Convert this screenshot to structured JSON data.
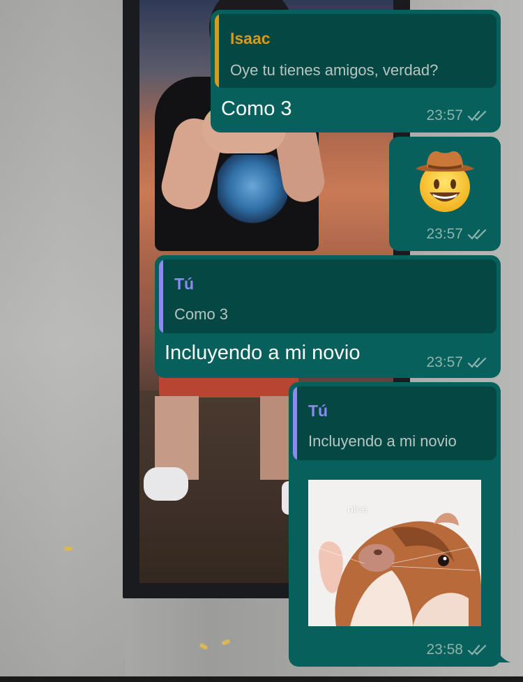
{
  "colors": {
    "bubble": "#07605c",
    "quote_bg": "#044743",
    "isaac_name": "#d89a1a",
    "tu_name": "#8a8af0",
    "time": "#8db4ae"
  },
  "messages": [
    {
      "quote": {
        "author": "Isaac",
        "text": "Oye tu tienes amigos, verdad?"
      },
      "text": "Como 3",
      "time": "23:57",
      "status_icon": "double-check-icon"
    },
    {
      "emoji": "cowboy-hat-face-emoji",
      "time": "23:57",
      "status_icon": "double-check-icon"
    },
    {
      "quote": {
        "author": "Tú",
        "text": "Como 3"
      },
      "text": "Incluyendo a mi novio",
      "time": "23:57",
      "status_icon": "double-check-icon"
    },
    {
      "quote": {
        "author": "Tú",
        "text": "Incluyendo a mi novio"
      },
      "sticker": {
        "caption": "nice",
        "subject": "hamster-sticker"
      },
      "time": "23:58",
      "status_icon": "double-check-icon"
    }
  ]
}
